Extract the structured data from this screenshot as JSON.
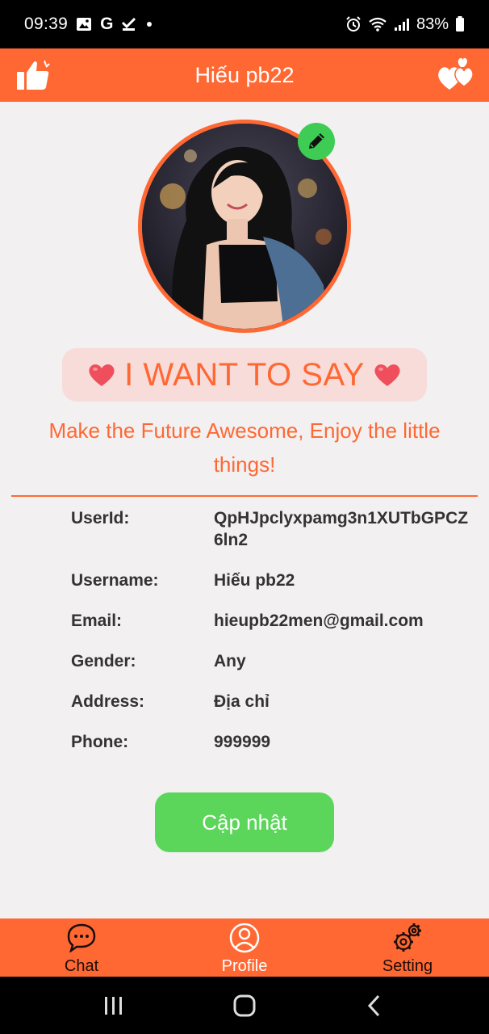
{
  "status_bar": {
    "time": "09:39",
    "notification_icons": [
      "image-icon",
      "google-icon",
      "task-check-icon",
      "dot-icon"
    ],
    "system_icons": [
      "alarm-icon",
      "wifi-icon",
      "signal-icon"
    ],
    "battery": "83%"
  },
  "header": {
    "title": "Hiếu pb22",
    "left_icon": "thumbs-up-icon",
    "right_icon": "hearts-icon"
  },
  "profile": {
    "edit_icon": "pencil-icon",
    "say_title": "I WANT TO SAY",
    "quote": "Make the Future Awesome, Enjoy the little things!"
  },
  "info": {
    "rows": [
      {
        "label": "UserId:",
        "value": "QpHJpclyxpamg3n1XUTbGPCZ6ln2"
      },
      {
        "label": "Username:",
        "value": "Hiếu pb22"
      },
      {
        "label": "Email:",
        "value": "hieupb22men@gmail.com"
      },
      {
        "label": "Gender:",
        "value": "Any"
      },
      {
        "label": "Address:",
        "value": "Địa chỉ"
      },
      {
        "label": "Phone:",
        "value": "999999"
      }
    ]
  },
  "update_button": "Cập nhật",
  "bottom_nav": {
    "items": [
      {
        "label": "Chat",
        "icon": "chat-icon"
      },
      {
        "label": "Profile",
        "icon": "profile-icon"
      },
      {
        "label": "Setting",
        "icon": "gear-icon"
      }
    ],
    "active": "Profile"
  },
  "colors": {
    "accent": "#ff6833",
    "background": "#f2f0f1",
    "button": "#5bd65b",
    "say_box": "#f7dcd9",
    "edit_badge": "#3ecc55"
  }
}
